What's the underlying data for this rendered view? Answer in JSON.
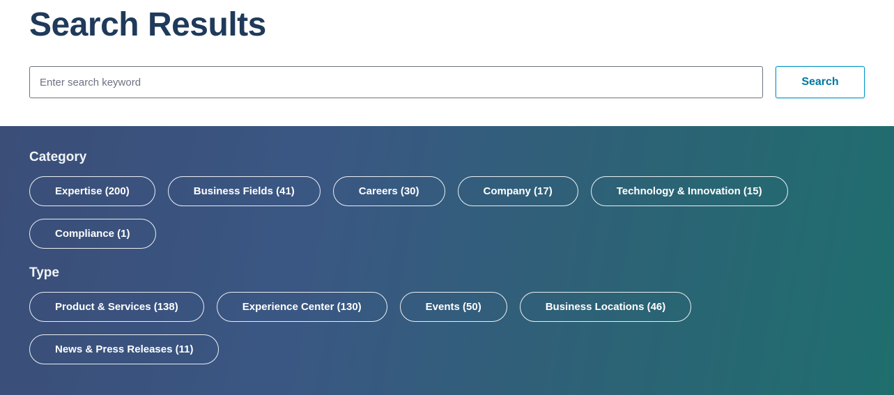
{
  "page_title": "Search Results",
  "search": {
    "placeholder": "Enter search keyword",
    "button_label": "Search"
  },
  "filters": {
    "category": {
      "heading": "Category",
      "items": [
        {
          "label": "Expertise (200)"
        },
        {
          "label": "Business Fields (41)"
        },
        {
          "label": "Careers (30)"
        },
        {
          "label": "Company (17)"
        },
        {
          "label": "Technology & Innovation (15)"
        },
        {
          "label": "Compliance (1)"
        }
      ]
    },
    "type": {
      "heading": "Type",
      "items": [
        {
          "label": "Product & Services (138)"
        },
        {
          "label": "Experience Center (130)"
        },
        {
          "label": "Events (50)"
        },
        {
          "label": "Business Locations (46)"
        },
        {
          "label": "News & Press Releases (11)"
        }
      ]
    }
  }
}
